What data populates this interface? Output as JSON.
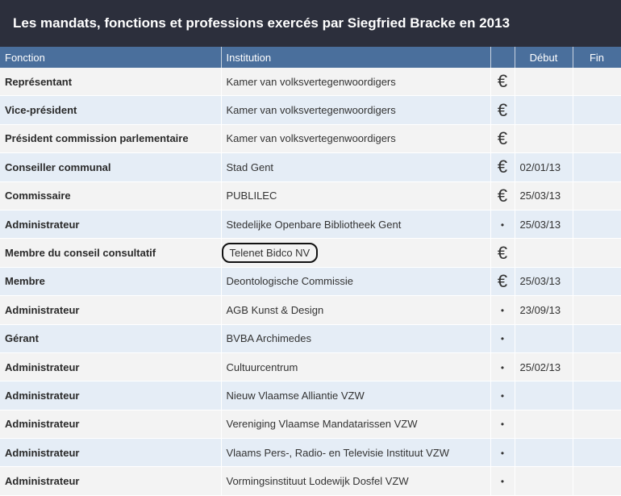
{
  "title": "Les mandats, fonctions et professions exercés par Siegfried Bracke en 2013",
  "columns": {
    "fonction": "Fonction",
    "institution": "Institution",
    "indicator": "",
    "debut": "Début",
    "fin": "Fin"
  },
  "rows": [
    {
      "fonction": "Représentant",
      "institution": "Kamer van volksvertegenwoordigers",
      "indicator": "€",
      "debut": "",
      "fin": ""
    },
    {
      "fonction": "Vice-président",
      "institution": "Kamer van volksvertegenwoordigers",
      "indicator": "€",
      "debut": "",
      "fin": ""
    },
    {
      "fonction": "Président commission parlementaire",
      "institution": "Kamer van volksvertegenwoordigers",
      "indicator": "€",
      "debut": "",
      "fin": ""
    },
    {
      "fonction": "Conseiller communal",
      "institution": "Stad Gent",
      "indicator": "€",
      "debut": "02/01/13",
      "fin": ""
    },
    {
      "fonction": "Commissaire",
      "institution": "PUBLILEC",
      "indicator": "€",
      "debut": "25/03/13",
      "fin": ""
    },
    {
      "fonction": "Administrateur",
      "institution": "Stedelijke Openbare Bibliotheek Gent",
      "indicator": "•",
      "debut": "25/03/13",
      "fin": ""
    },
    {
      "fonction": "Membre du conseil consultatif",
      "institution": "Telenet Bidco NV",
      "indicator": "€",
      "debut": "",
      "fin": "",
      "circled": true
    },
    {
      "fonction": "Membre",
      "institution": "Deontologische Commissie",
      "indicator": "€",
      "debut": "25/03/13",
      "fin": ""
    },
    {
      "fonction": "Administrateur",
      "institution": "AGB Kunst & Design",
      "indicator": "•",
      "debut": "23/09/13",
      "fin": ""
    },
    {
      "fonction": "Gérant",
      "institution": "BVBA Archimedes",
      "indicator": "•",
      "debut": "",
      "fin": ""
    },
    {
      "fonction": "Administrateur",
      "institution": "Cultuurcentrum",
      "indicator": "•",
      "debut": "25/02/13",
      "fin": ""
    },
    {
      "fonction": "Administrateur",
      "institution": "Nieuw Vlaamse Alliantie VZW",
      "indicator": "•",
      "debut": "",
      "fin": ""
    },
    {
      "fonction": "Administrateur",
      "institution": "Vereniging Vlaamse Mandatarissen VZW",
      "indicator": "•",
      "debut": "",
      "fin": ""
    },
    {
      "fonction": "Administrateur",
      "institution": "Vlaams Pers-, Radio- en Televisie Instituut VZW",
      "indicator": "•",
      "debut": "",
      "fin": ""
    },
    {
      "fonction": "Administrateur",
      "institution": "Vormingsinstituut Lodewijk Dosfel VZW",
      "indicator": "•",
      "debut": "",
      "fin": ""
    }
  ]
}
